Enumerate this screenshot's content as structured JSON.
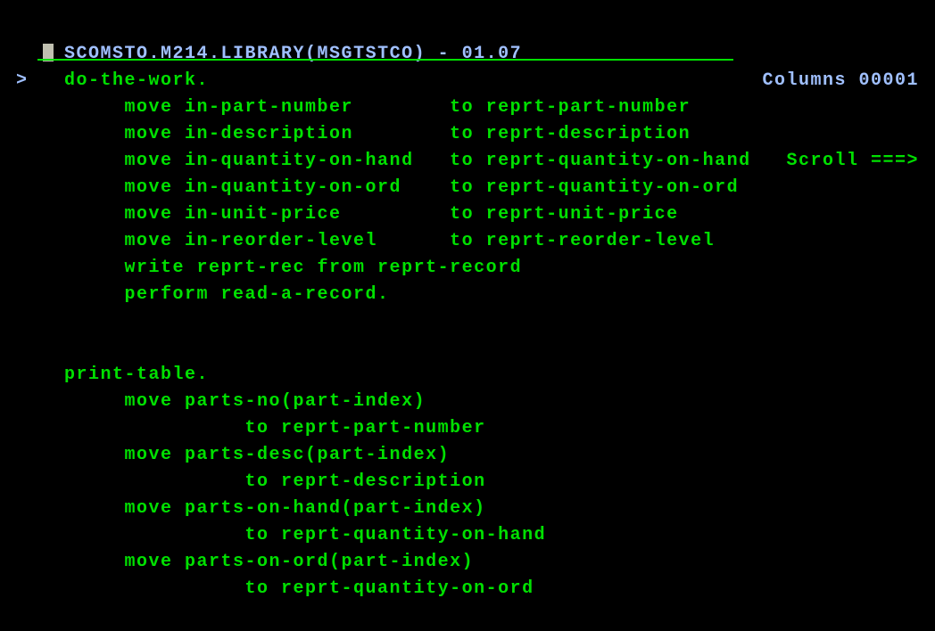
{
  "header": {
    "title": "SCOMSTO.M214.LIBRARY(MSGTSTCO) - 01.07",
    "columns_label": "Columns 00001"
  },
  "prompt": {
    "char": ">",
    "scroll_label": "Scroll ===>"
  },
  "code": [
    "    do-the-work.",
    "         move in-part-number        to reprt-part-number",
    "         move in-description        to reprt-description",
    "         move in-quantity-on-hand   to reprt-quantity-on-hand",
    "         move in-quantity-on-ord    to reprt-quantity-on-ord",
    "         move in-unit-price         to reprt-unit-price",
    "         move in-reorder-level      to reprt-reorder-level",
    "         write reprt-rec from reprt-record",
    "         perform read-a-record.",
    "",
    "",
    "    print-table.",
    "         move parts-no(part-index)",
    "                   to reprt-part-number",
    "         move parts-desc(part-index)",
    "                   to reprt-description",
    "         move parts-on-hand(part-index)",
    "                   to reprt-quantity-on-hand",
    "         move parts-on-ord(part-index)",
    "                   to reprt-quantity-on-ord"
  ]
}
